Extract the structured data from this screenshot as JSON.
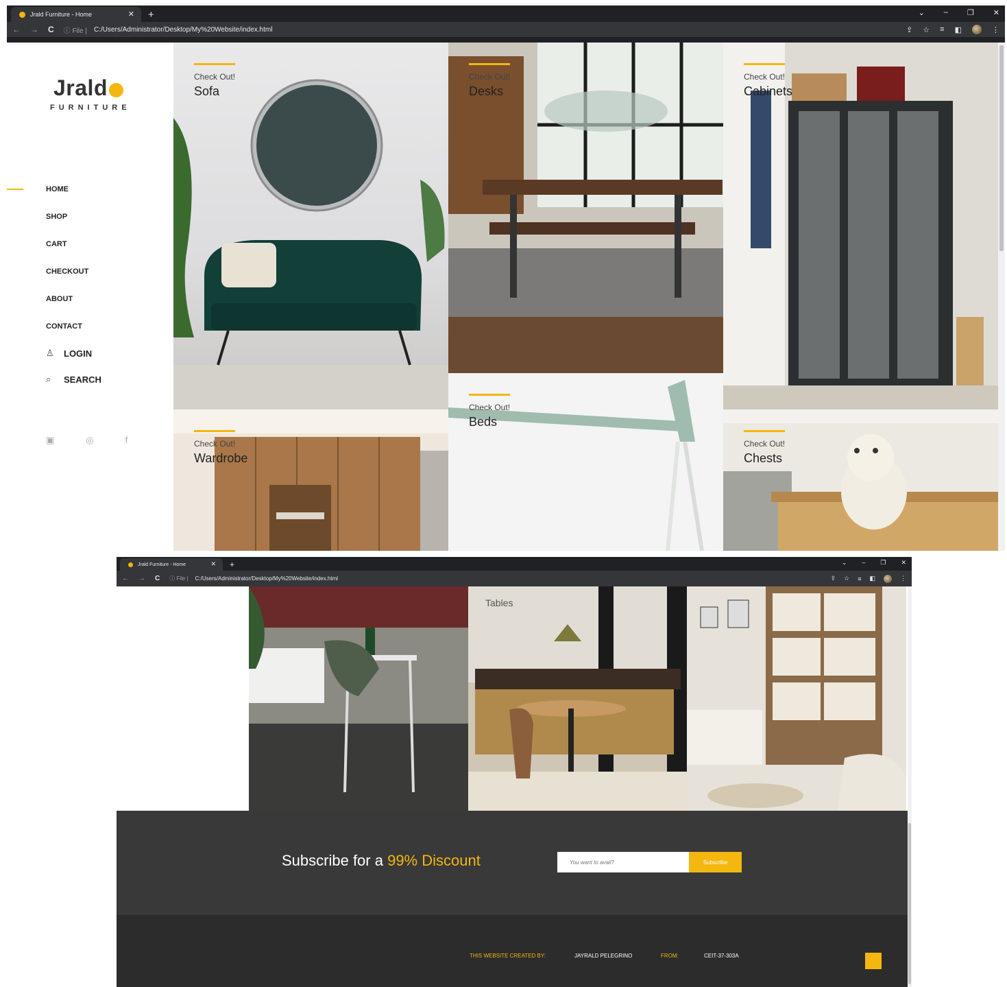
{
  "browser": {
    "tab_title": "Jrald Furniture - Home",
    "tab_close": "✕",
    "new_tab": "+",
    "url_prefix": "File",
    "url": "C:/Users/Administrator/Desktop/My%20Website/index.html",
    "info_icon": "ⓘ"
  },
  "logo": {
    "word": "Jrald",
    "sub": "FURNITURE"
  },
  "menu": {
    "home": "HOME",
    "shop": "SHOP",
    "cart": "CART",
    "checkout": "CHECKOUT",
    "about": "ABOUT",
    "contact": "CONTACT",
    "login": "LOGIN",
    "search": "SEARCH"
  },
  "tiles": {
    "check_label": "Check Out!",
    "sofa": "Sofa",
    "desks": "Desks",
    "cabinets": "Cabinets",
    "wardrobe": "Wardrobe",
    "beds": "Beds",
    "chests": "Chests",
    "tables": "Tables"
  },
  "subscribe": {
    "title": "Subscribe for a ",
    "highlight": "99% Discount",
    "placeholder": "You want to avail?",
    "button": "Subscribe"
  },
  "footer": {
    "created_label": "THIS WEBSITE CREATED BY:",
    "author": "JAYRALD PELEGRINO",
    "from_label": "FROM:",
    "section": "CEIT-37-303A"
  },
  "colors": {
    "accent": "#f4b70f",
    "dark": "#393939",
    "footer": "#2c2c2c"
  }
}
